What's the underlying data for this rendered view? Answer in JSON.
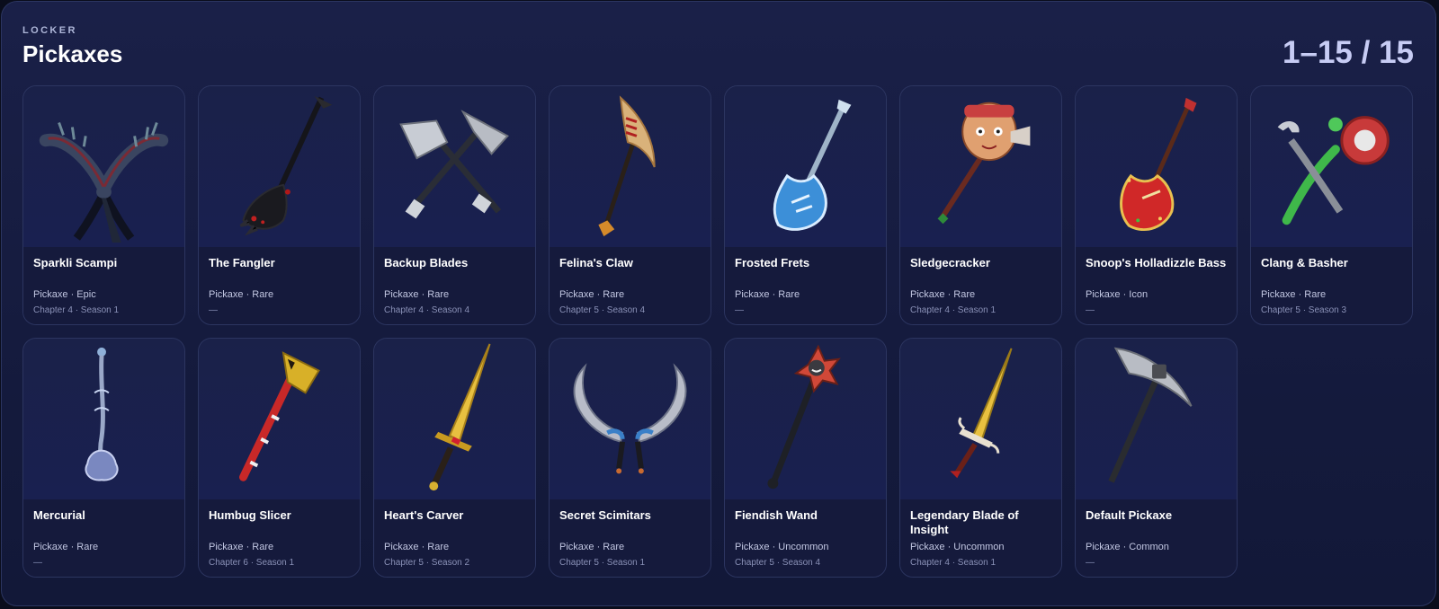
{
  "header": {
    "eyebrow": "LOCKER",
    "title": "Pickaxes",
    "count": "1–15 / 15"
  },
  "items": [
    {
      "name": "Sparkli Scampi",
      "type": "Pickaxe · Epic",
      "season": "Chapter 4 · Season 1"
    },
    {
      "name": "The Fangler",
      "type": "Pickaxe · Rare",
      "season": "—"
    },
    {
      "name": "Backup Blades",
      "type": "Pickaxe · Rare",
      "season": "Chapter 4 · Season 4"
    },
    {
      "name": "Felina's Claw",
      "type": "Pickaxe · Rare",
      "season": "Chapter 5 · Season 4"
    },
    {
      "name": "Frosted Frets",
      "type": "Pickaxe · Rare",
      "season": "—"
    },
    {
      "name": "Sledgecracker",
      "type": "Pickaxe · Rare",
      "season": "Chapter 4 · Season 1"
    },
    {
      "name": "Snoop's Holladizzle Bass",
      "type": "Pickaxe · Icon",
      "season": "—"
    },
    {
      "name": "Clang & Basher",
      "type": "Pickaxe · Rare",
      "season": "Chapter 5 · Season 3"
    },
    {
      "name": "Mercurial",
      "type": "Pickaxe · Rare",
      "season": "—"
    },
    {
      "name": "Humbug Slicer",
      "type": "Pickaxe · Rare",
      "season": "Chapter 6 · Season 1"
    },
    {
      "name": "Heart's Carver",
      "type": "Pickaxe · Rare",
      "season": "Chapter 5 · Season 2"
    },
    {
      "name": "Secret Scimitars",
      "type": "Pickaxe · Rare",
      "season": "Chapter 5 · Season 1"
    },
    {
      "name": "Fiendish Wand",
      "type": "Pickaxe · Uncommon",
      "season": "Chapter 5 · Season 4"
    },
    {
      "name": "Legendary Blade of Insight",
      "type": "Pickaxe · Uncommon",
      "season": "Chapter 4 · Season 1"
    },
    {
      "name": "Default Pickaxe",
      "type": "Pickaxe · Common",
      "season": "—"
    }
  ]
}
